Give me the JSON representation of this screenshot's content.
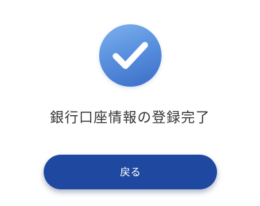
{
  "completion": {
    "icon": "checkmark-circle-icon",
    "message": "銀行口座情報の登録完了"
  },
  "actions": {
    "back_label": "戻る"
  },
  "colors": {
    "icon_gradient_light": "#7fb1ec",
    "icon_gradient_dark": "#3a6cc6",
    "button_background": "#1f48a0",
    "button_text": "#ffffff",
    "message_text": "#333333"
  }
}
